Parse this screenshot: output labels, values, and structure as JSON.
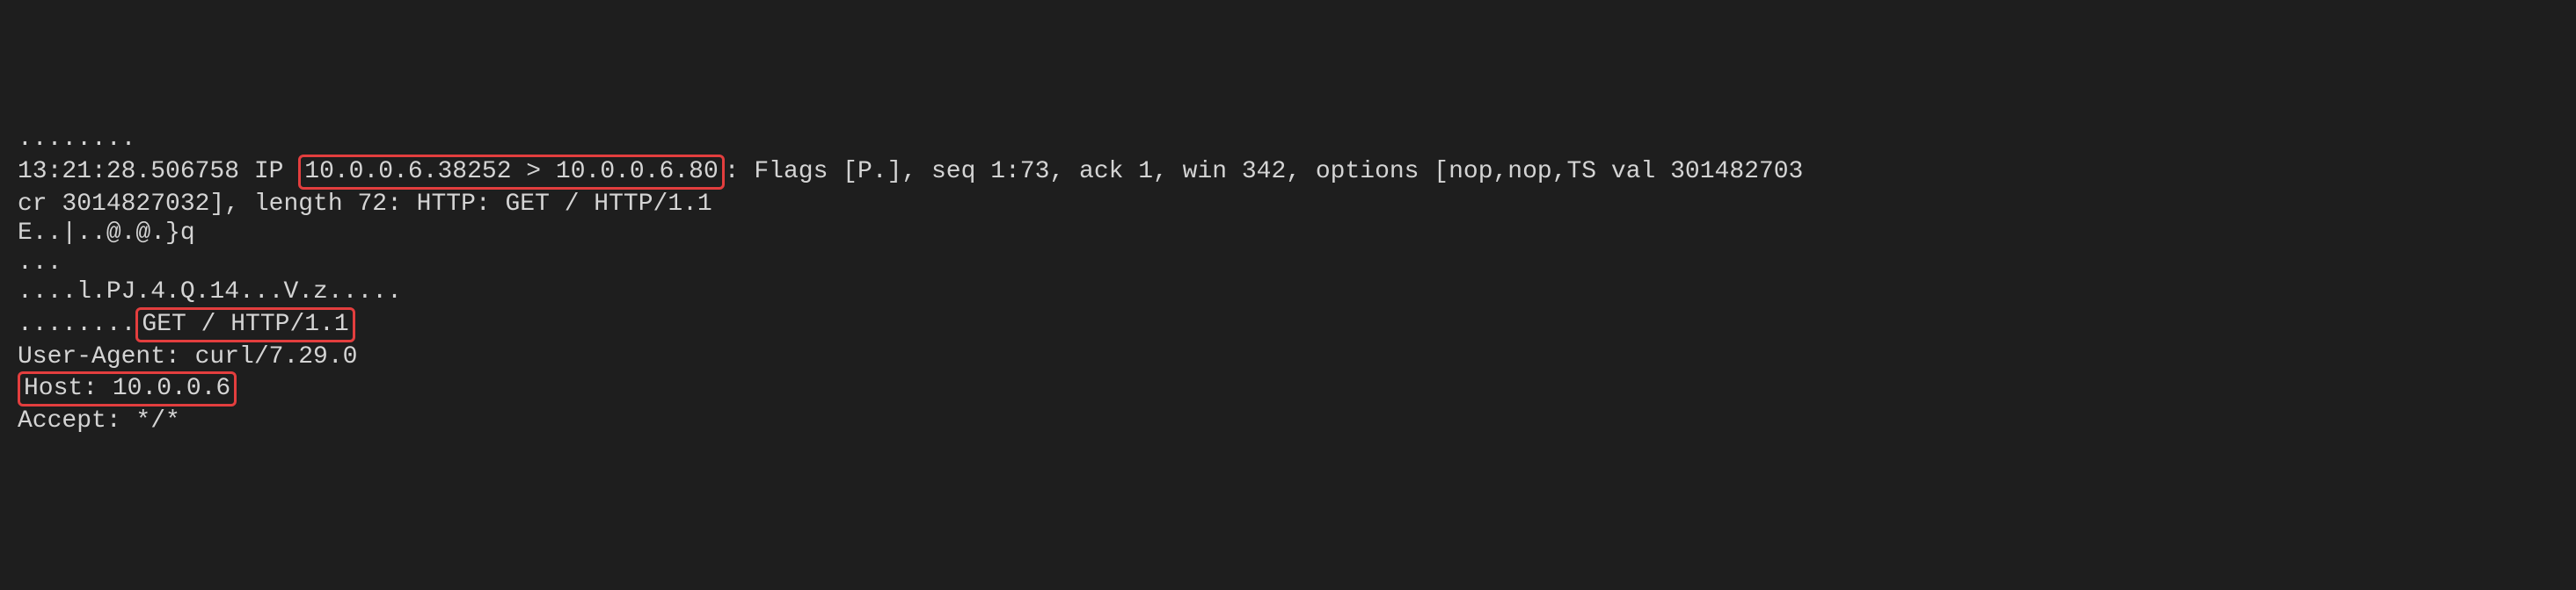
{
  "terminal": {
    "line1": "........",
    "line2_pre": "13:21:28.506758 IP ",
    "line2_highlight": "10.0.0.6.38252 > 10.0.0.6.80",
    "line2_post": ": Flags [P.], seq 1:73, ack 1, win 342, options [nop,nop,TS val 301482703",
    "line3": "cr 3014827032], length 72: HTTP: GET / HTTP/1.1",
    "line4": "E..|..@.@.}q",
    "line5": "...",
    "line6": "....l.PJ.4.Q.14...V.z.....",
    "line7_pre": "........",
    "line7_highlight": "GET / HTTP/1.1",
    "line8": "User-Agent: curl/7.29.0",
    "line9_highlight": "Host: 10.0.0.6",
    "line10": "Accept: */*"
  }
}
